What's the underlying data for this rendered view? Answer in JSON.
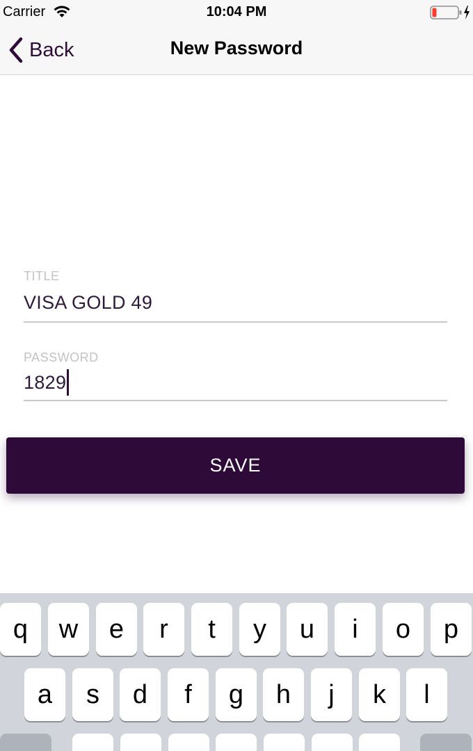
{
  "status_bar": {
    "carrier": "Carrier",
    "time": "10:04 PM",
    "battery_level": 0.1,
    "battery_color": "#ff3b30",
    "charging": true
  },
  "nav": {
    "back_label": "Back",
    "title": "New Password"
  },
  "form": {
    "title_label": "TITLE",
    "title_value": "VISA GOLD 49",
    "password_label": "PASSWORD",
    "password_value": "1829"
  },
  "save_label": "SAVE",
  "keyboard": {
    "row1": [
      "q",
      "w",
      "e",
      "r",
      "t",
      "y",
      "u",
      "i",
      "o",
      "p"
    ],
    "row2": [
      "a",
      "s",
      "d",
      "f",
      "g",
      "h",
      "j",
      "k",
      "l"
    ]
  },
  "colors": {
    "accent": "#2d0a38",
    "label": "#c4c2c8",
    "keyboard_bg": "#d1d4da"
  }
}
